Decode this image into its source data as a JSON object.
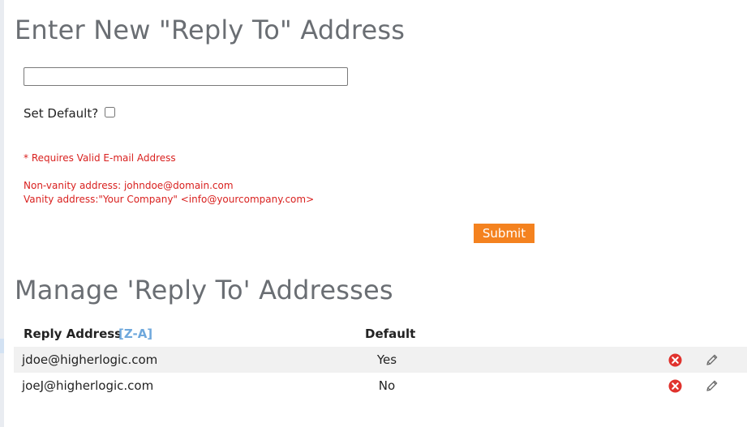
{
  "form": {
    "title": "Enter New \"Reply To\" Address",
    "email_value": "",
    "set_default_label": "Set Default?",
    "set_default_checked": false,
    "note_required": "* Requires Valid E-mail Address",
    "note_non_vanity": "Non-vanity address: johndoe@domain.com",
    "note_vanity": "Vanity address:\"Your Company\" <info@yourcompany.com>",
    "submit_label": "Submit",
    "accent_color": "#f4821f",
    "note_color": "#d9211f"
  },
  "list": {
    "title": "Manage 'Reply To' Addresses",
    "columns": {
      "address": "Reply Address",
      "sort_link": "[Z-A]",
      "default": "Default"
    },
    "rows": [
      {
        "address": "jdoe@higherlogic.com",
        "default": "Yes",
        "delete_icon": "delete-icon",
        "edit_icon": "pencil-icon"
      },
      {
        "address": "joeJ@higherlogic.com",
        "default": "No",
        "delete_icon": "delete-icon",
        "edit_icon": "pencil-icon"
      }
    ]
  }
}
